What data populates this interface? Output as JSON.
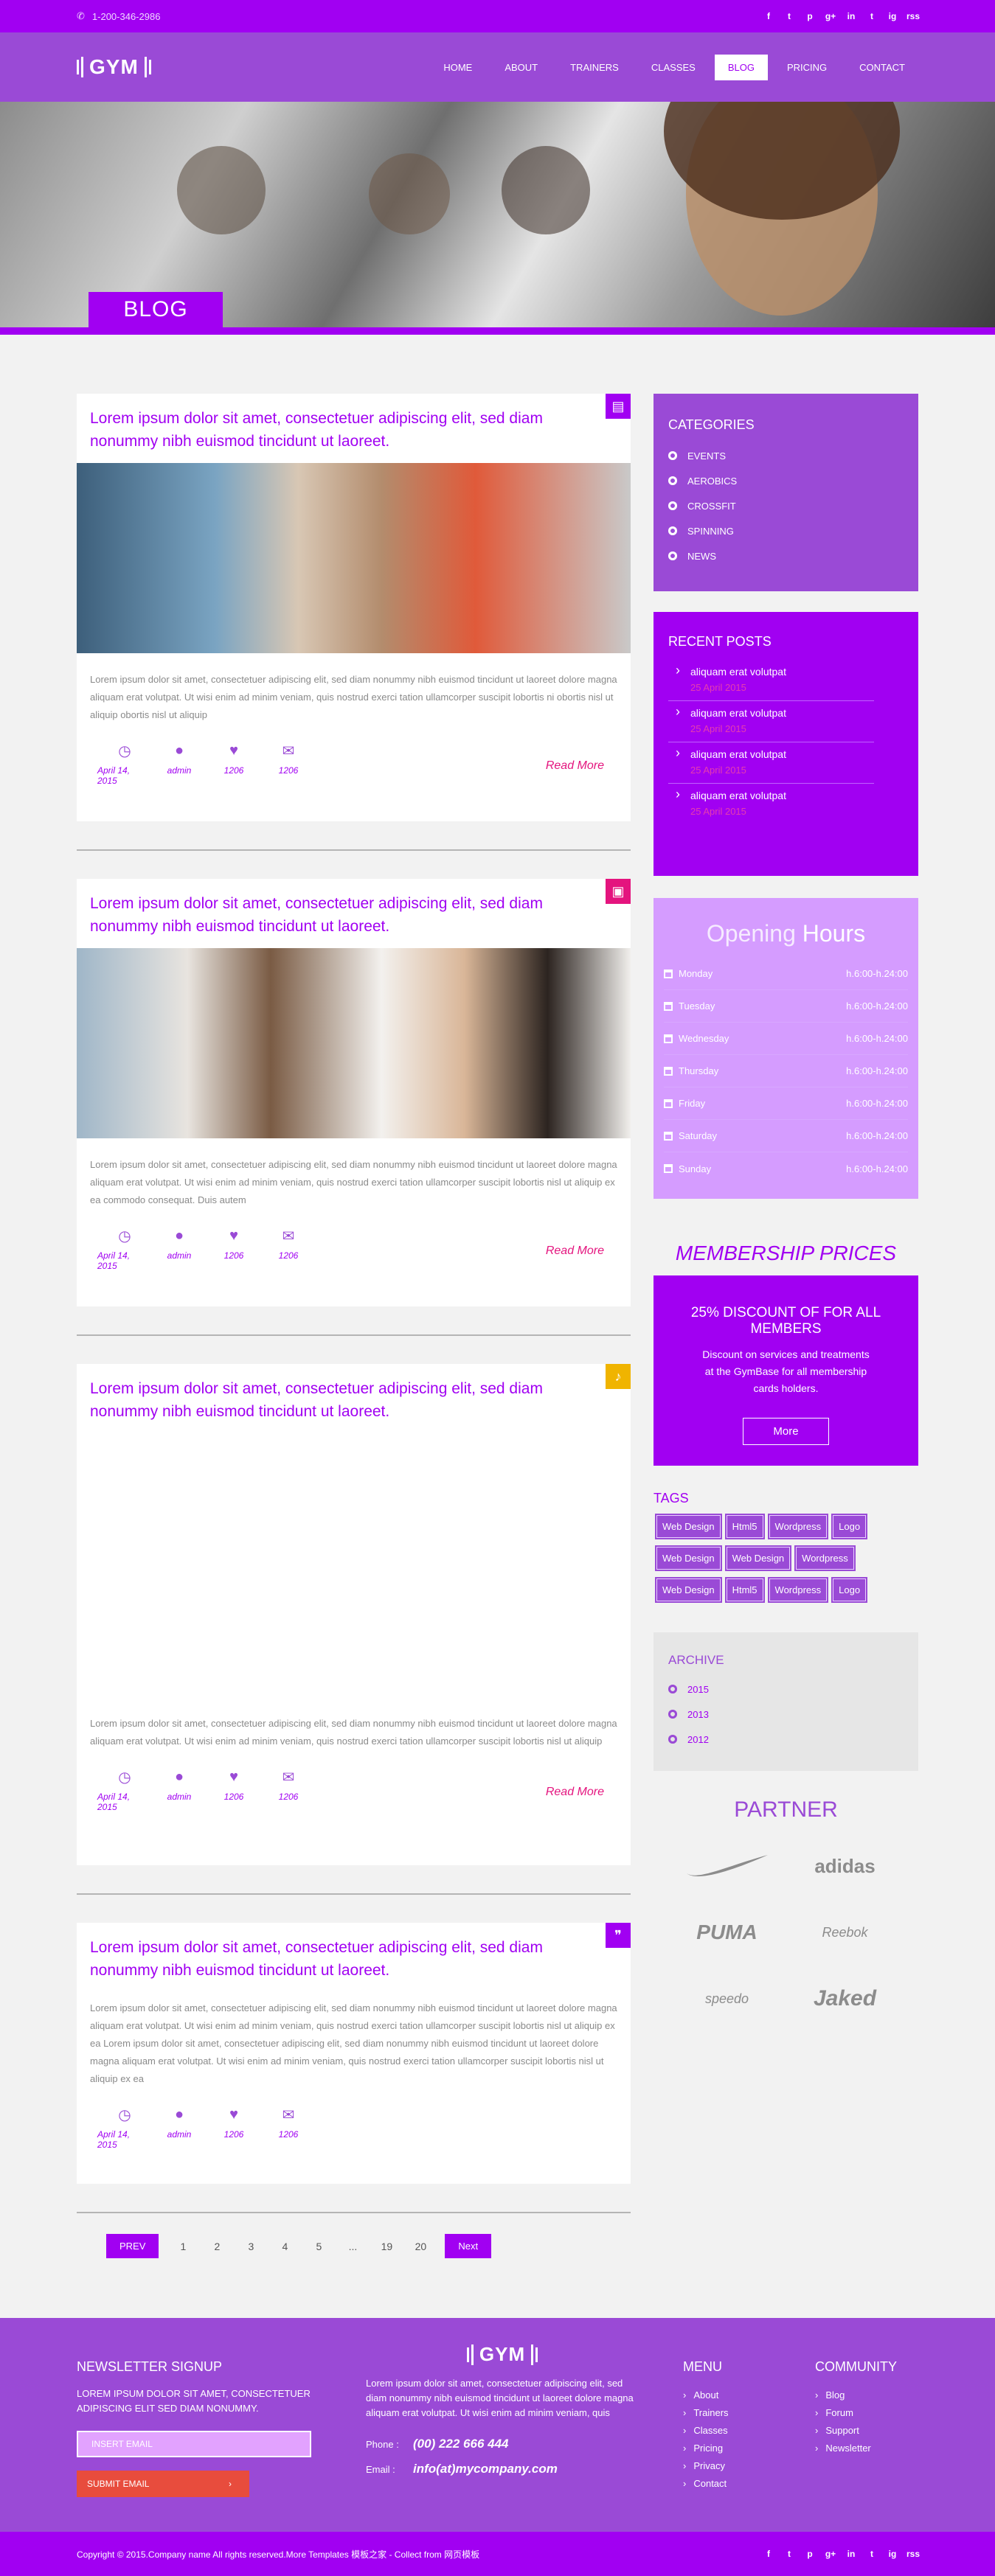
{
  "topbar": {
    "phone": "1-200-346-2986",
    "socials": [
      "f",
      "t",
      "p",
      "g+",
      "in",
      "t",
      "ig",
      "rss"
    ]
  },
  "nav": {
    "logo": "GYM",
    "items": [
      {
        "label": "HOME"
      },
      {
        "label": "ABOUT"
      },
      {
        "label": "TRAINERS"
      },
      {
        "label": "CLASSES"
      },
      {
        "label": "BLOG",
        "active": true
      },
      {
        "label": "PRICING"
      },
      {
        "label": "CONTACT"
      }
    ]
  },
  "hero": {
    "title": "BLOG"
  },
  "posts": [
    {
      "title": "Lorem ipsum dolor sit amet, consectetuer adipiscing elit, sed diam nonummy nibh euismod tincidunt ut laoreet.",
      "icon": "document-icon",
      "icon_color": "#a100f2",
      "text": "Lorem ipsum dolor sit amet, consectetuer adipiscing elit, sed diam nonummy nibh euismod tincidunt ut laoreet dolore magna aliquam erat volutpat. Ut wisi enim ad minim veniam, quis nostrud exerci tation ullamcorper suscipit lobortis ni obortis nisl ut aliquip obortis nisl ut aliquip",
      "date": "April 14, 2015",
      "author": "admin",
      "likes": "1206",
      "comments": "1206",
      "read_more": "Read More"
    },
    {
      "title": "Lorem ipsum dolor sit amet, consectetuer adipiscing elit, sed diam nonummy nibh euismod tincidunt ut laoreet.",
      "icon": "image-icon",
      "icon_color": "#e4147e",
      "text": "Lorem ipsum dolor sit amet, consectetuer adipiscing elit, sed diam nonummy nibh euismod tincidunt ut laoreet dolore magna aliquam erat volutpat. Ut wisi enim ad minim veniam, quis nostrud exerci tation ullamcorper suscipit lobortis nisl ut aliquip ex ea commodo consequat. Duis autem",
      "date": "April 14, 2015",
      "author": "admin",
      "likes": "1206",
      "comments": "1206",
      "read_more": "Read More"
    },
    {
      "title": "Lorem ipsum dolor sit amet, consectetuer adipiscing elit, sed diam nonummy nibh euismod tincidunt ut laoreet.",
      "icon": "music-icon",
      "icon_color": "#f0b400",
      "text": "Lorem ipsum dolor sit amet, consectetuer adipiscing elit, sed diam nonummy nibh euismod tincidunt ut laoreet dolore magna aliquam erat volutpat. Ut wisi enim ad minim veniam, quis nostrud exerci tation ullamcorper suscipit lobortis nisl ut aliquip",
      "date": "April 14, 2015",
      "author": "admin",
      "likes": "1206",
      "comments": "1206",
      "read_more": "Read More"
    },
    {
      "title": "Lorem ipsum dolor sit amet, consectetuer adipiscing elit, sed diam nonummy nibh euismod tincidunt ut laoreet.",
      "icon": "quote-icon",
      "icon_color": "#a100f2",
      "text": "Lorem ipsum dolor sit amet, consectetuer adipiscing elit, sed diam nonummy nibh euismod tincidunt ut laoreet dolore magna aliquam erat volutpat. Ut wisi enim ad minim veniam, quis nostrud exerci tation ullamcorper suscipit lobortis nisl ut aliquip ex ea Lorem ipsum dolor sit amet, consectetuer adipiscing elit, sed diam nonummy nibh euismod tincidunt ut laoreet dolore magna aliquam erat volutpat. Ut wisi enim ad minim veniam, quis nostrud exerci tation ullamcorper suscipit lobortis nisl ut aliquip ex ea",
      "date": "April 14, 2015",
      "author": "admin",
      "likes": "1206",
      "comments": "1206",
      "read_more": ""
    }
  ],
  "pager": {
    "prev": "PREV",
    "pages": [
      "1",
      "2",
      "3",
      "4",
      "5",
      "...",
      "19",
      "20"
    ],
    "next": "Next"
  },
  "categories": {
    "title": "CATEGORIES",
    "items": [
      "EVENTS",
      "AEROBICS",
      "CROSSFIT",
      "SPINNING",
      "NEWS"
    ]
  },
  "recent": {
    "title": "RECENT POSTS",
    "items": [
      {
        "title": "aliquam erat volutpat",
        "date": "25 April 2015"
      },
      {
        "title": "aliquam erat volutpat",
        "date": "25 April 2015"
      },
      {
        "title": "aliquam erat volutpat",
        "date": "25 April 2015"
      },
      {
        "title": "aliquam erat volutpat",
        "date": "25 April 2015"
      }
    ]
  },
  "hours": {
    "title_a": "Opening",
    "title_b": "Hours",
    "rows": [
      {
        "day": "Monday",
        "time": "h.6:00-h.24:00"
      },
      {
        "day": "Tuesday",
        "time": "h.6:00-h.24:00"
      },
      {
        "day": "Wednesday",
        "time": "h.6:00-h.24:00"
      },
      {
        "day": "Thursday",
        "time": "h.6:00-h.24:00"
      },
      {
        "day": "Friday",
        "time": "h.6:00-h.24:00"
      },
      {
        "day": "Saturday",
        "time": "h.6:00-h.24:00"
      },
      {
        "day": "Sunday",
        "time": "h.6:00-h.24:00"
      }
    ]
  },
  "membership": {
    "title": "MEMBERSHIP PRICES",
    "headline": "25% DISCOUNT OF FOR ALL MEMBERS",
    "text": "Discount on services and treatments at the GymBase for all membership cards holders.",
    "button": "More"
  },
  "tags": {
    "title": "TAGS",
    "items": [
      "Web Design",
      "Html5",
      "Wordpress",
      "Logo",
      "Web Design",
      "Web Design",
      "Wordpress",
      "Web Design",
      "Html5",
      "Wordpress",
      "Logo"
    ]
  },
  "archive": {
    "title": "ARCHIVE",
    "items": [
      "2015",
      "2013",
      "2012"
    ]
  },
  "partners": {
    "title": "PARTNER",
    "items": [
      "nike",
      "adidas",
      "PUMA",
      "Reebok",
      "speedo",
      "Jaked"
    ]
  },
  "footer": {
    "newsletter_title": "NEWSLETTER SIGNUP",
    "newsletter_text": "LOREM IPSUM DOLOR SIT AMET, CONSECTETUER ADIPISCING ELIT SED DIAM NONUMMY.",
    "email_placeholder": "INSERT EMAIL",
    "submit": "SUBMIT EMAIL",
    "logo": "GYM",
    "about": "Lorem ipsum dolor sit amet, consectetuer adipiscing elit, sed diam nonummy nibh euismod tincidunt ut laoreet dolore magna aliquam erat volutpat. Ut wisi enim ad minim veniam, quis",
    "phone_label": "Phone :",
    "phone": "(00) 222 666 444",
    "email_label": "Email :",
    "email": "info(at)mycompany.com",
    "menu_title": "MENU",
    "menu": [
      "About",
      "Trainers",
      "Classes",
      "Pricing",
      "Privacy",
      "Contact"
    ],
    "community_title": "COMMUNITY",
    "community": [
      "Blog",
      "Forum",
      "Support",
      "Newsletter"
    ],
    "copyright": "Copyright © 2015.Company name All rights reserved.More Templates 模板之家 - Collect from 网页模板"
  }
}
